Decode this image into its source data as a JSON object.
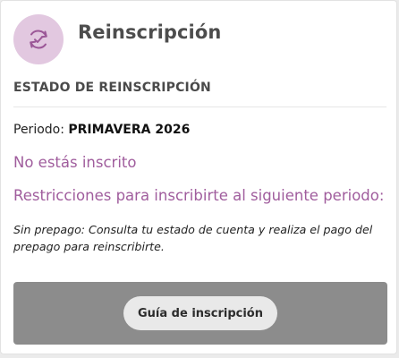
{
  "header": {
    "title": "Reinscripción",
    "icon": "refresh-check-icon",
    "icon_bg_color": "#e2c8e0",
    "icon_color": "#9b5797"
  },
  "status_section": {
    "heading": "ESTADO DE REINSCRIPCIÓN",
    "period_label": "Periodo:",
    "period_value": "PRIMAVERA 2026",
    "status_text": "No estás inscrito",
    "restrictions_heading": "Restricciones para inscribirte al siguiente periodo:",
    "restriction_note": "Sin prepago: Consulta tu estado de cuenta y realiza el pago del prepago para reinscribirte.",
    "accent_color": "#a05d9d"
  },
  "footer": {
    "button_label": "Guía de inscripción",
    "bar_color": "#8c8c8c"
  }
}
